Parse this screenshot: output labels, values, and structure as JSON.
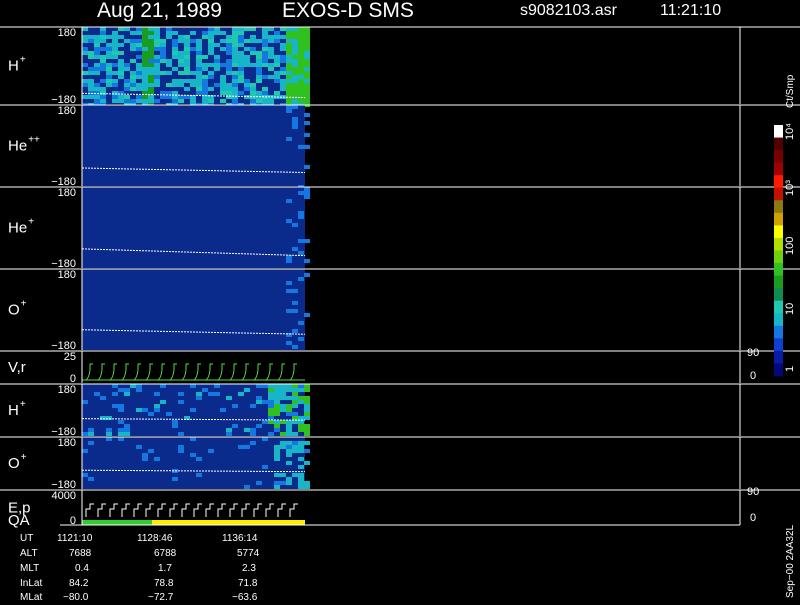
{
  "header": {
    "date": "Aug 21, 1989",
    "instrument": "EXOS-D SMS",
    "file": "s9082103.asr",
    "time": "11:21:10"
  },
  "colors": {
    "background": "#000000",
    "panel_fill": "#0a2a8c",
    "trace": "#ffffff",
    "velocity_trace": "#55dd44",
    "qa_good": "#33cc33",
    "qa_flag": "#ffee00"
  },
  "colorbar": {
    "unit": "Ct/Smp",
    "tick_labels": [
      "10⁴",
      "10³",
      "100",
      "10",
      "1"
    ],
    "scale": "log",
    "colors": [
      "#05087a",
      "#0a1ca6",
      "#0e3fd1",
      "#1578e0",
      "#18b4c8",
      "#20c8b0",
      "#108c50",
      "#1a9c20",
      "#30c020",
      "#70d010",
      "#b0e000",
      "#ffff00",
      "#d0a000",
      "#8c7a10",
      "#c01000",
      "#ff1a00",
      "#a00000",
      "#780000",
      "#500000",
      "#ffffff"
    ]
  },
  "panels": [
    {
      "label": "H",
      "charge": "+",
      "ytop": "180",
      "ybottom": "−180"
    },
    {
      "label": "He",
      "charge": "++",
      "ytop": "180",
      "ybottom": "−180"
    },
    {
      "label": "He",
      "charge": "+",
      "ytop": "180",
      "ybottom": "−180"
    },
    {
      "label": "O",
      "charge": "+",
      "ytop": "180",
      "ybottom": "−180"
    },
    {
      "label": "V,r",
      "charge": "",
      "ytop": "25",
      "ybottom": "0",
      "right_top": "90",
      "right_bottom": "0"
    },
    {
      "label": "H",
      "charge": "+",
      "ytop": "180",
      "ybottom": "−180"
    },
    {
      "label": "O",
      "charge": "+",
      "ytop": "180",
      "ybottom": "−180"
    },
    {
      "label": "E,p",
      "label2": "QA",
      "charge": "",
      "ytop": "4000",
      "ybottom": "0",
      "right_top": "90",
      "right_bottom": "0"
    }
  ],
  "footer": {
    "rows": [
      {
        "name": "UT",
        "values": [
          "1121:10",
          "1128:46",
          "1136:14"
        ]
      },
      {
        "name": "ALT",
        "values": [
          "7688",
          "6788",
          "5774"
        ]
      },
      {
        "name": "MLT",
        "values": [
          "0.4",
          "1.7",
          "2.3"
        ]
      },
      {
        "name": "InLat",
        "values": [
          "84.2",
          "78.8",
          "71.8"
        ]
      },
      {
        "name": "MLat",
        "values": [
          "−80.0",
          "−72.7",
          "−63.6"
        ]
      }
    ],
    "side_text": "Sep−00  2AA32L"
  },
  "chart_data": {
    "type": "heatmap",
    "title": "Aug 21, 1989   EXOS-D SMS",
    "x_ticks_ut": [
      "1121:10",
      "1128:46",
      "1136:14"
    ],
    "data_coverage_fraction_of_time_axis": 0.34,
    "colorbar": {
      "unit": "Ct/Smp",
      "scale": "log",
      "range": [
        1,
        10000
      ]
    },
    "series": [
      {
        "name": "H+",
        "ylim": [
          -180,
          180
        ],
        "trace_start": -130,
        "trace_end": -150
      },
      {
        "name": "He++",
        "ylim": [
          -180,
          180
        ],
        "trace_start": -100,
        "trace_end": -120
      },
      {
        "name": "He+",
        "ylim": [
          -180,
          180
        ],
        "trace_start": -95,
        "trace_end": -125
      },
      {
        "name": "O+",
        "ylim": [
          -180,
          180
        ],
        "trace_start": -90,
        "trace_end": -110
      },
      {
        "name": "V,r",
        "ylim": [
          0,
          25
        ],
        "right_axis": [
          0,
          90
        ]
      },
      {
        "name": "H+",
        "ylim": [
          -180,
          180
        ],
        "trace_start": -60,
        "trace_end": -70
      },
      {
        "name": "O+",
        "ylim": [
          -180,
          180
        ],
        "trace_start": -50,
        "trace_end": -60
      },
      {
        "name": "E,p",
        "ylim": [
          0,
          4000
        ],
        "right_axis": [
          0,
          90
        ]
      }
    ]
  }
}
